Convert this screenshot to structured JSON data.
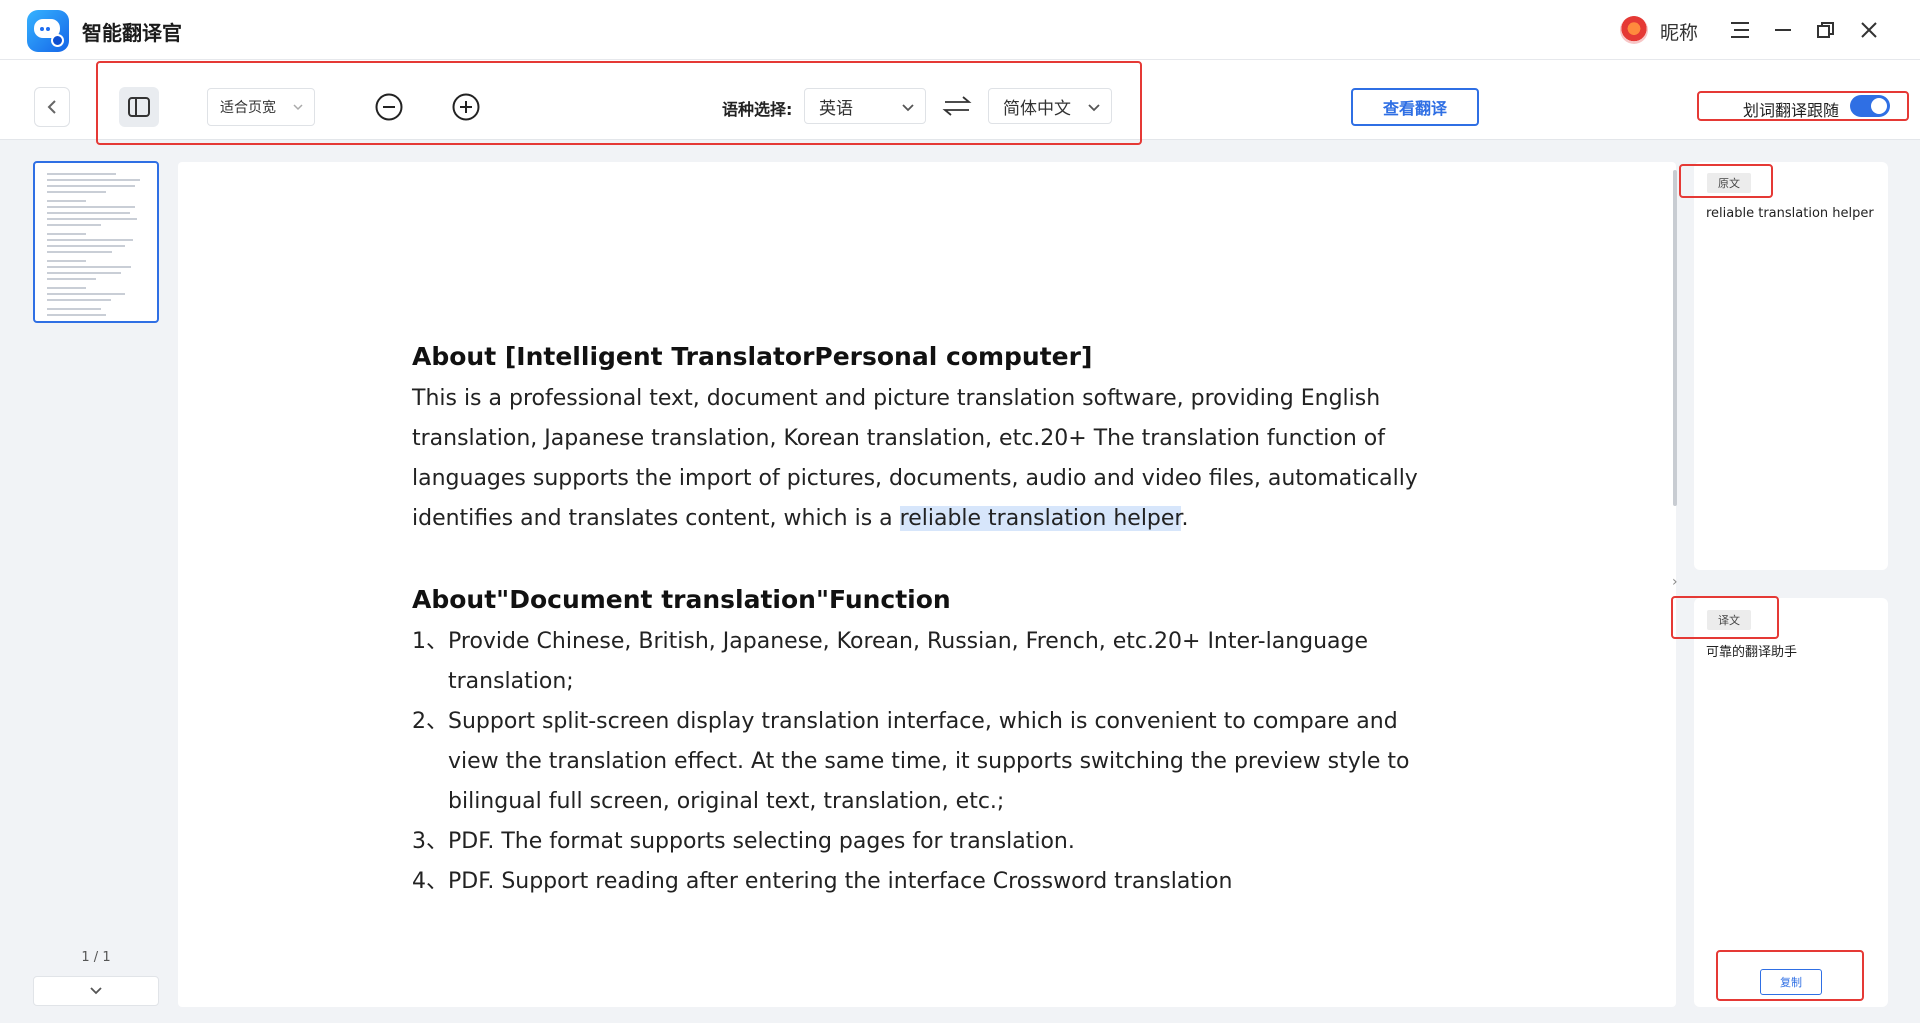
{
  "app": {
    "title": "智能翻译官",
    "nickname": "昵称"
  },
  "toolbar": {
    "fit_mode": "适合页宽",
    "language_label": "语种选择:",
    "source_language": "英语",
    "target_language": "简体中文",
    "view_translation": "查看翻译",
    "follow_label": "划词翻译跟随",
    "follow_enabled": true
  },
  "thumbnails": {
    "page_indicator": "1 / 1"
  },
  "document": {
    "section1_title": "About [Intelligent TranslatorPersonal computer]",
    "section1_body_before": "This is a professional text, document and picture translation software, providing English translation, Japanese translation, Korean translation, etc.20+ The translation function of languages supports the import of pictures, documents, audio and video files, automatically identifies and translates content, which is a",
    "section1_highlight": "reliable translation helper",
    "section1_body_after": ".",
    "section2_title": "About\"Document translation\"Function",
    "items": [
      {
        "num": "1、",
        "text": "Provide Chinese, British, Japanese, Korean, Russian, French, etc.20+ Inter-language translation;"
      },
      {
        "num": "2、",
        "text": "Support split-screen display translation interface, which is convenient to compare and view the translation effect. At the same time, it supports switching the preview style to bilingual full screen, original text, translation, etc.;"
      },
      {
        "num": "3、",
        "text": "PDF. The format supports selecting pages for translation."
      },
      {
        "num": "4、",
        "text": "PDF. Support reading after entering the interface Crossword translation"
      }
    ]
  },
  "side_panel": {
    "original_tag": "原文",
    "original_text": "reliable translation helper",
    "translation_tag": "译文",
    "translation_text": "可靠的翻译助手",
    "copy_label": "复制"
  },
  "colors": {
    "accent": "#2f6fe4",
    "annotation_red": "#e53935",
    "highlight": "#d7e6fb"
  }
}
